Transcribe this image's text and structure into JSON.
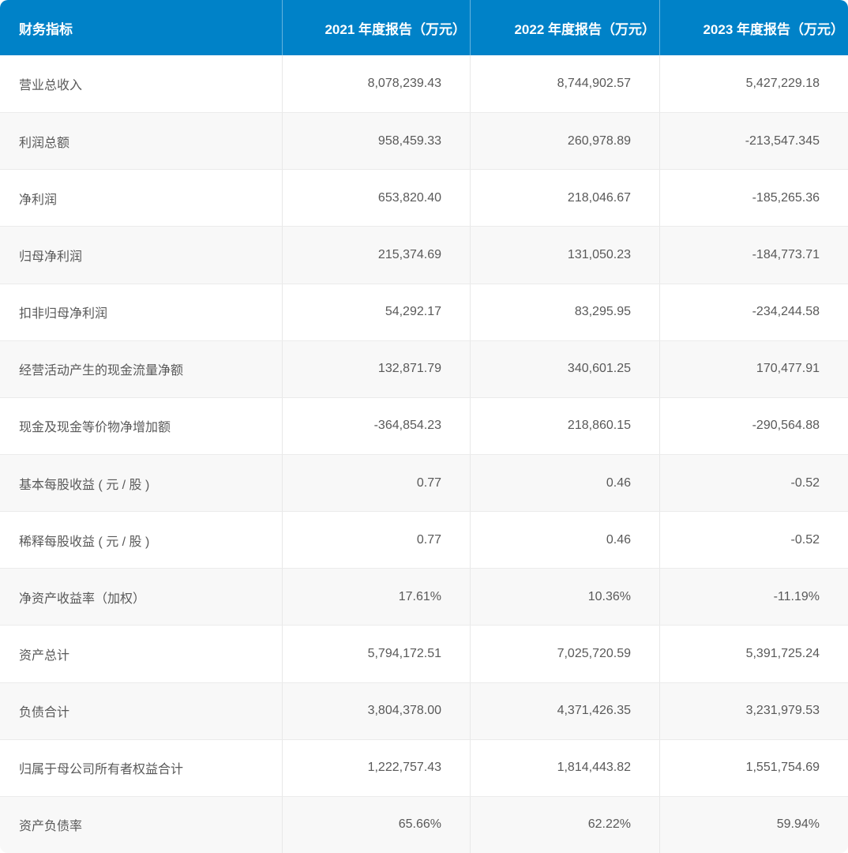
{
  "chart_data": {
    "type": "table",
    "title": "财务指标年度报告对比表",
    "columns": [
      "财务指标",
      "2021 年度报告（万元）",
      "2022 年度报告（万元）",
      "2023 年度报告（万元）"
    ],
    "rows": [
      [
        "营业总收入",
        "8,078,239.43",
        "8,744,902.57",
        "5,427,229.18"
      ],
      [
        "利润总额",
        "958,459.33",
        "260,978.89",
        "-213,547.345"
      ],
      [
        "净利润",
        "653,820.40",
        "218,046.67",
        "-185,265.36"
      ],
      [
        "归母净利润",
        "215,374.69",
        "131,050.23",
        "-184,773.71"
      ],
      [
        "扣非归母净利润",
        "54,292.17",
        "83,295.95",
        "-234,244.58"
      ],
      [
        "经营活动产生的现金流量净额",
        "132,871.79",
        "340,601.25",
        "170,477.91"
      ],
      [
        "现金及现金等价物净增加额",
        "-364,854.23",
        "218,860.15",
        "-290,564.88"
      ],
      [
        "基本每股收益 ( 元 / 股 )",
        "0.77",
        "0.46",
        "-0.52"
      ],
      [
        "稀释每股收益 ( 元 / 股 )",
        "0.77",
        "0.46",
        "-0.52"
      ],
      [
        "净资产收益率（加权）",
        "17.61%",
        "10.36%",
        "-11.19%"
      ],
      [
        "资产总计",
        "5,794,172.51",
        "7,025,720.59",
        "5,391,725.24"
      ],
      [
        "负债合计",
        "3,804,378.00",
        "4,371,426.35",
        "3,231,979.53"
      ],
      [
        "归属于母公司所有者权益合计",
        "1,222,757.43",
        "1,814,443.82",
        "1,551,754.69"
      ],
      [
        "资产负债率",
        "65.66%",
        "62.22%",
        "59.94%"
      ]
    ],
    "layout": {
      "first_row_is_header": true,
      "zebra_striping": true,
      "value_alignment": "right",
      "header_corner_radius_px": 10
    }
  },
  "colors": {
    "header_bg": "#0082C8",
    "header_text": "#FFFFFF",
    "header_divider": "rgba(255,255,255,0.4)",
    "row_bg": "#FFFFFF",
    "row_alt_bg": "#F8F8F8",
    "row_border": "#EBEBEB",
    "column_divider": "#E8E8E8",
    "body_text": "#595959"
  }
}
